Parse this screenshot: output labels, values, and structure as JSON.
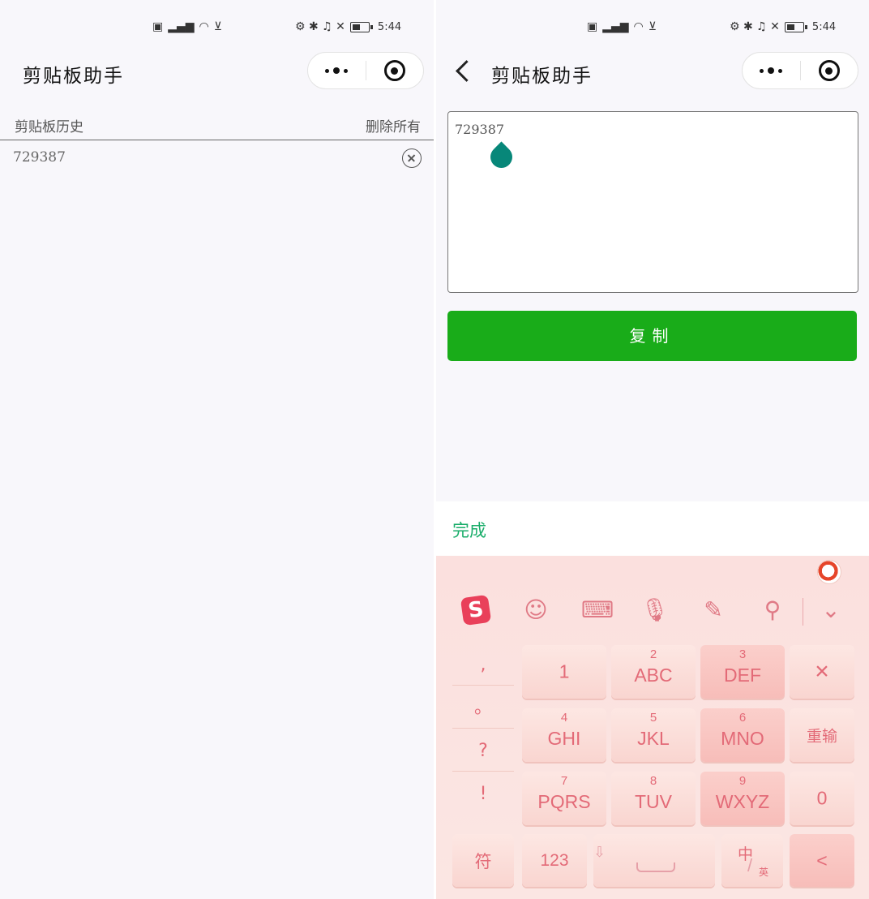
{
  "left": {
    "status": {
      "right_glyphs": "◙ ≋ ♪ ✕",
      "time": "5:44"
    },
    "nav": {
      "title": "剪贴板助手"
    },
    "history": {
      "header_label": "剪贴板历史",
      "delete_all_label": "删除所有",
      "items": [
        {
          "value": "729387"
        }
      ]
    }
  },
  "right": {
    "status": {
      "time": "5:44"
    },
    "nav": {
      "title": "剪贴板助手"
    },
    "editor": {
      "value": "729387"
    },
    "copy_button_label": "复制",
    "done_label": "完成",
    "keyboard": {
      "logo_letter": "S",
      "punctuation": [
        ",",
        "。",
        "?",
        "!"
      ],
      "digit_keys": [
        {
          "num": "",
          "label": "1"
        },
        {
          "num": "2",
          "label": "ABC"
        },
        {
          "num": "3",
          "label": "DEF"
        },
        {
          "num": "4",
          "label": "GHI"
        },
        {
          "num": "5",
          "label": "JKL"
        },
        {
          "num": "6",
          "label": "MNO"
        },
        {
          "num": "7",
          "label": "PQRS"
        },
        {
          "num": "8",
          "label": "TUV"
        },
        {
          "num": "9",
          "label": "WXYZ"
        }
      ],
      "delete_label": "✕",
      "enter_label": "重输",
      "zero_label": "0",
      "symbol_label": "符",
      "num_label": "123",
      "lang_main": "中",
      "lang_sub": "英",
      "back_label": "<"
    }
  },
  "icons": [
    "signal-icon",
    "wifi-icon",
    "battery-icon",
    "more-icon",
    "target-icon",
    "back-icon",
    "clear-icon",
    "emoji-icon",
    "keyboard-icon",
    "mic-icon",
    "handwriting-icon",
    "search-icon",
    "collapse-icon"
  ],
  "colors": {
    "accent_green": "#19ac19",
    "done_green": "#1aad6a",
    "keyboard_text": "#e36a77",
    "cursor_teal": "#078779"
  }
}
